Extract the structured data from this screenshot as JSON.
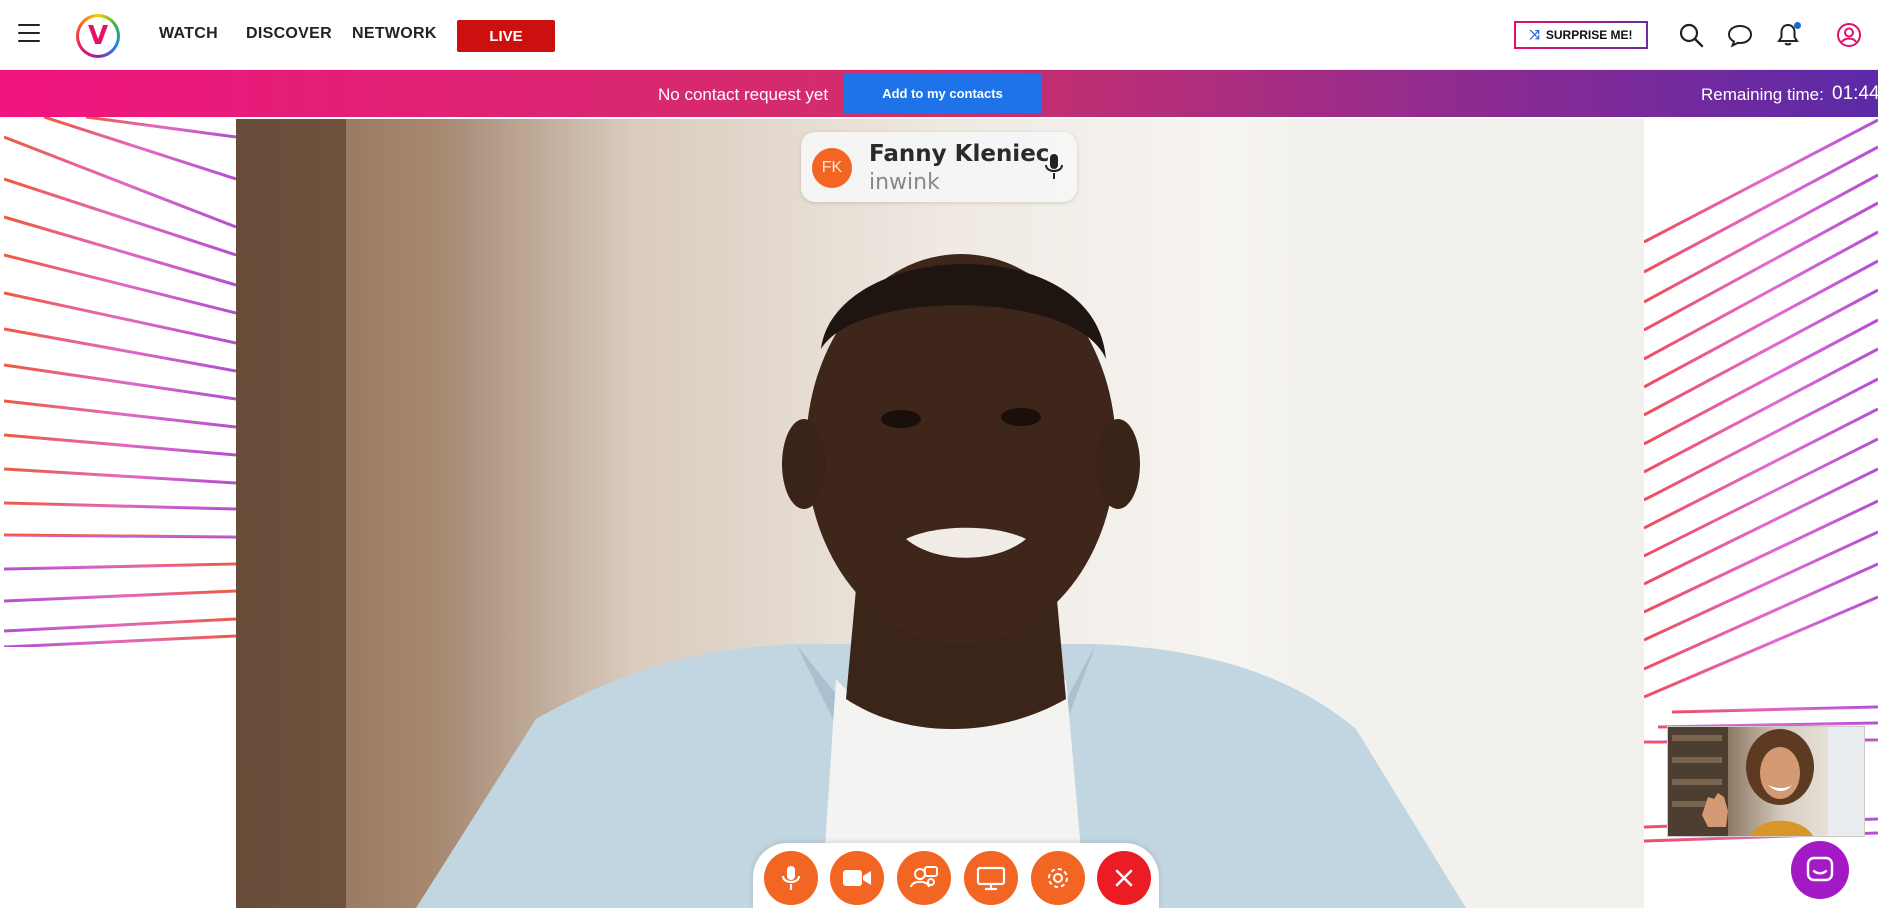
{
  "nav": {
    "menu_icon": "hamburger-icon",
    "logo_letter": "V",
    "links": [
      "WATCH",
      "DISCOVER",
      "NETWORK"
    ],
    "live_label": "LIVE",
    "surprise_label": "SURPRISE ME!",
    "icons": [
      "search-icon",
      "chat-icon",
      "bell-icon",
      "user-icon"
    ],
    "live_color": "#cc1010"
  },
  "banner": {
    "message": "No contact request yet",
    "add_button": "Add to my contacts",
    "remaining_label": "Remaining time:",
    "remaining_time": "01:44",
    "gradient_start": "#f0157f",
    "gradient_end": "#5b2aa8",
    "button_color": "#1e73e8"
  },
  "call": {
    "caller": {
      "initials": "FK",
      "name": "Fanny Kleniec",
      "organization": "inwink"
    },
    "controls": [
      "microphone-icon",
      "camera-icon",
      "participants-icon",
      "screen-share-icon",
      "settings-icon",
      "hang-up-icon"
    ],
    "accent": "#f26522",
    "hangup_color": "#ec1c24"
  },
  "chat_launcher_icon": "message-icon"
}
